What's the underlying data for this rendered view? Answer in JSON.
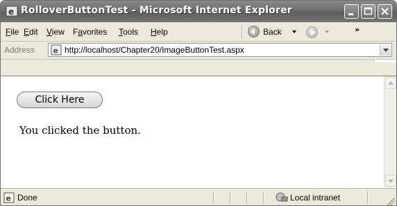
{
  "window": {
    "title": "RolloverButtonTest - Microsoft Internet Explorer"
  },
  "menubar": {
    "items": [
      {
        "label": "File",
        "accel": "F"
      },
      {
        "label": "Edit",
        "accel": "E"
      },
      {
        "label": "View",
        "accel": "V"
      },
      {
        "label": "Favorites",
        "accel": "a"
      },
      {
        "label": "Tools",
        "accel": "T"
      },
      {
        "label": "Help",
        "accel": "H"
      }
    ],
    "back_label": "Back",
    "chevrons": "»"
  },
  "address": {
    "label": "Address",
    "url": "http://localhost/Chapter20/ImageButtonTest.aspx"
  },
  "page": {
    "button_label": "Click Here",
    "message": "You clicked the button."
  },
  "status": {
    "text": "Done",
    "zone": "Local intranet"
  }
}
